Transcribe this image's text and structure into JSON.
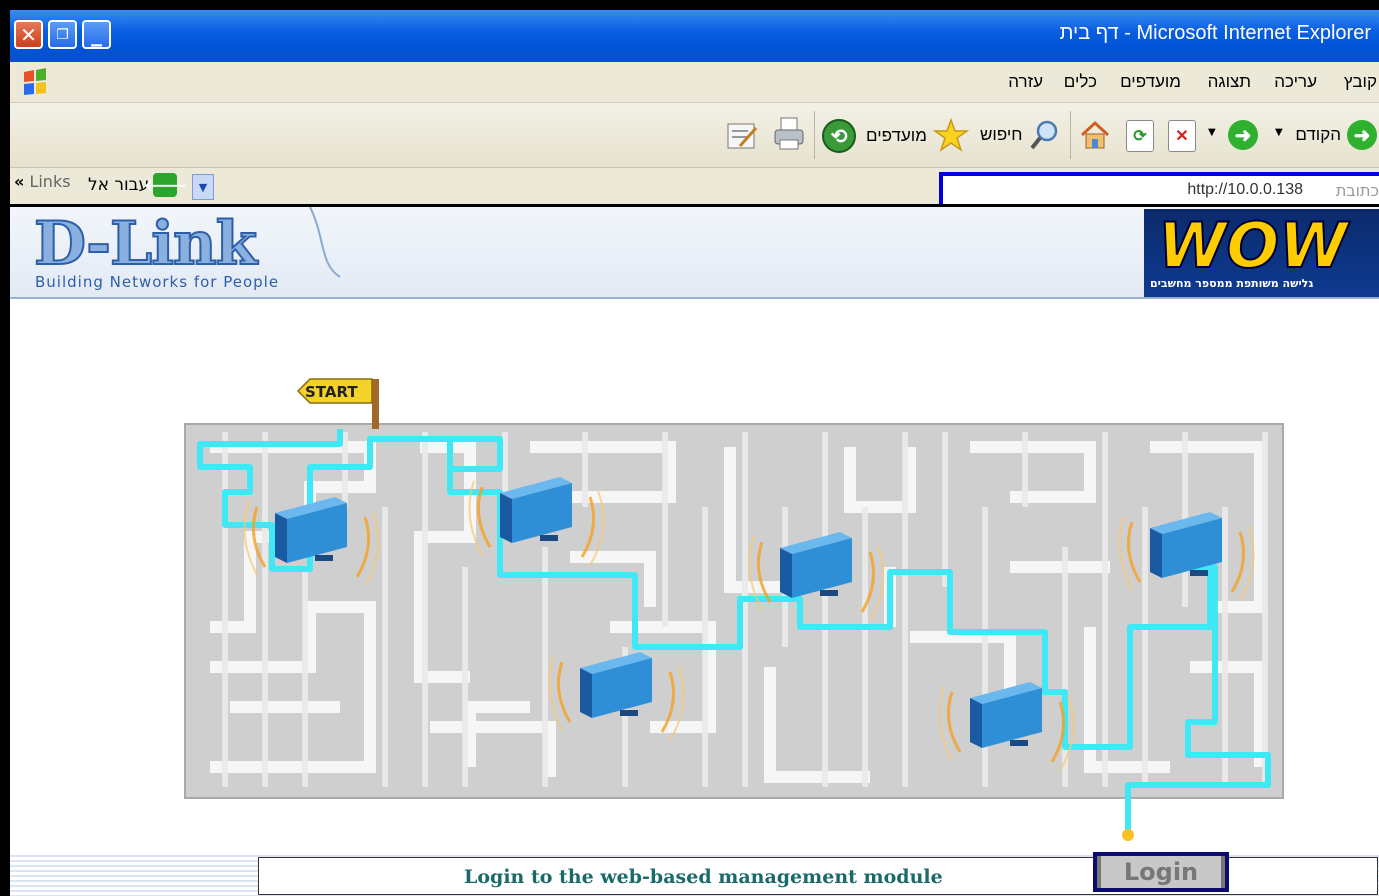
{
  "window": {
    "title": "דף בית - Microsoft Internet Explorer"
  },
  "menu": {
    "items": [
      "קובץ",
      "עריכה",
      "תצוגה",
      "מועדפים",
      "כלים",
      "עזרה"
    ]
  },
  "toolbar": {
    "back_label": "הקודם",
    "search_label": "חיפוש",
    "favorites_label": "מועדפים"
  },
  "address": {
    "label": "כתובת",
    "url": "http://10.0.0.138",
    "go_label": "עבור אל",
    "links_label": "Links"
  },
  "banner": {
    "brand": "D-Link",
    "tagline": "Building Networks for People",
    "ad_text": "WOW",
    "ad_subtitle": "גלישה משותפת ממספר מחשבים"
  },
  "maze": {
    "start_label": "START"
  },
  "login": {
    "prompt": "Login to the web-based management module",
    "button": "Login"
  },
  "colors": {
    "xp_blue": "#0054d6",
    "path_cyan": "#3fe8f5",
    "router_blue": "#2f8fd6",
    "login_border": "#0b0b70"
  },
  "icons": [
    "close-icon",
    "restore-icon",
    "minimize-icon",
    "windows-logo-icon",
    "back-icon",
    "forward-icon",
    "stop-icon",
    "refresh-icon",
    "home-icon",
    "search-icon",
    "favorites-icon",
    "history-icon",
    "print-icon",
    "edit-icon",
    "go-icon"
  ]
}
